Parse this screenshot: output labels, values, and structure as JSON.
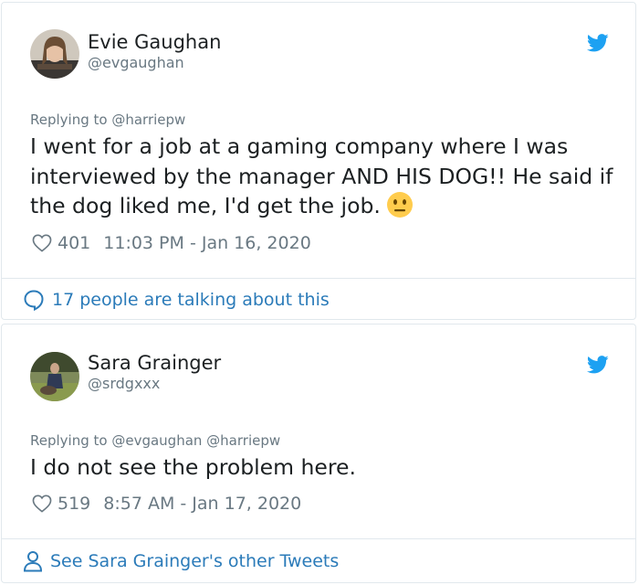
{
  "tweets": [
    {
      "author_name": "Evie Gaughan",
      "author_handle": "@evgaughan",
      "replying_label": "Replying to",
      "replying_to": "@harriepw",
      "text": "I went for a job at a gaming company where I was interviewed by the manager AND HIS DOG!! He said if the dog liked me, I'd get the job.",
      "emoji": "neutral-face-emoji",
      "likes": "401",
      "timestamp": "11:03 PM - Jan 16, 2020",
      "footer_link": "17 people are talking about this",
      "footer_icon": "speech-bubble-icon"
    },
    {
      "author_name": "Sara Grainger",
      "author_handle": "@srdgxxx",
      "replying_label": "Replying to",
      "replying_to": "@evgaughan @harriepw",
      "text": "I do not see the problem here.",
      "likes": "519",
      "timestamp": "8:57 AM - Jan 17, 2020",
      "footer_link": "See Sara Grainger's other Tweets",
      "footer_icon": "person-icon"
    }
  ],
  "colors": {
    "twitter_blue": "#1da1f2",
    "link_blue": "#2b7bb9",
    "muted_text": "#697882",
    "border": "#e1e8ed"
  }
}
